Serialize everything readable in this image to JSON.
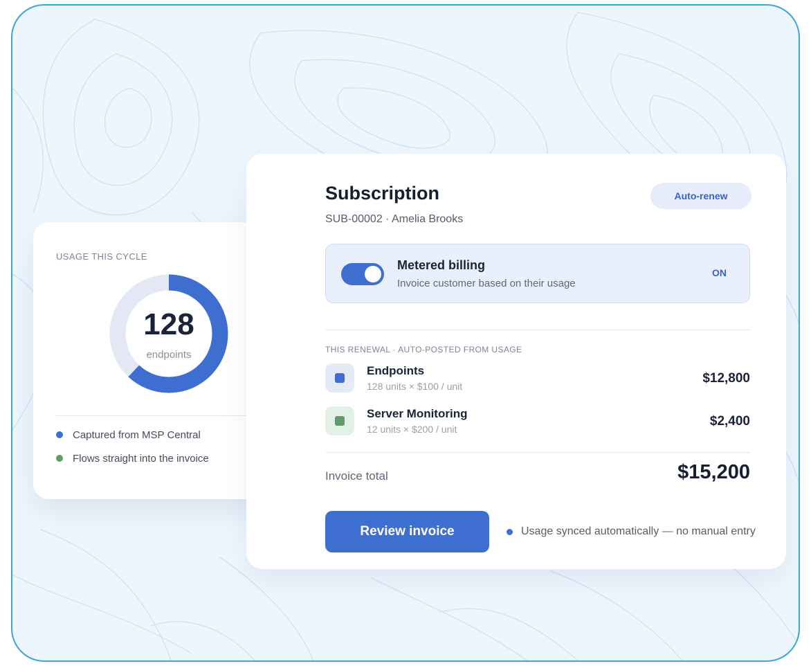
{
  "colors": {
    "accent": "#3d6ed0",
    "accent_light": "#e4e8f4",
    "green": "#5e9c6a",
    "frame_border": "#3aa6d8",
    "background": "#eef6fd"
  },
  "usage_card": {
    "title": "USAGE THIS CYCLE",
    "value": "128",
    "unit": "endpoints",
    "donut_fill_fraction": 0.62,
    "legend": [
      {
        "label": "Captured from MSP Central",
        "color": "#3d6ed0"
      },
      {
        "label": "Flows straight into the invoice",
        "color": "#5e9c6a"
      }
    ]
  },
  "subscription": {
    "title": "Subscription",
    "id_line": "SUB-00002 · Amelia Brooks",
    "badge": "Auto-renew",
    "metered": {
      "title": "Metered billing",
      "description": "Invoice customer based on their usage",
      "state": "ON",
      "toggle_on": true
    },
    "section_label": "THIS RENEWAL · AUTO-POSTED FROM USAGE",
    "items": [
      {
        "name": "Endpoints",
        "detail": "128 units × $100 / unit",
        "amount": "$12,800",
        "icon": "square-blue-icon"
      },
      {
        "name": "Server Monitoring",
        "detail": "12 units × $200 / unit",
        "amount": "$2,400",
        "icon": "square-green-icon"
      }
    ],
    "total_label": "Invoice total",
    "total_value": "$15,200",
    "review_button": "Review invoice",
    "sync_note": "Usage synced automatically — no manual entry"
  }
}
